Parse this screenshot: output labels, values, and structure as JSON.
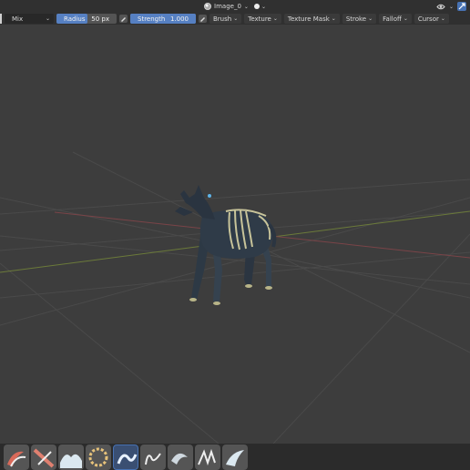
{
  "header": {
    "image_name": "Image_0",
    "icons": [
      "globe-icon",
      "chevron-down-icon",
      "dot-icon",
      "chevron-down-icon",
      "visibility-icon",
      "navigation-gizmo-icon"
    ]
  },
  "toolbar": {
    "blend_mode": "Mix",
    "radius": {
      "label": "Radius",
      "value": "50 px"
    },
    "strength": {
      "label": "Strength",
      "value": "1.000",
      "fraction": 1.0
    },
    "menus": [
      "Brush",
      "Texture",
      "Texture Mask",
      "Stroke",
      "Falloff",
      "Cursor"
    ]
  },
  "colors": {
    "accent": "#4772b3",
    "viewport_bg": "#3d3d3d",
    "header_bg": "#303030"
  },
  "brushes": [
    {
      "name": "brush-draw-icon"
    },
    {
      "name": "brush-soften-icon"
    },
    {
      "name": "brush-smear-icon"
    },
    {
      "name": "brush-clone-icon"
    },
    {
      "name": "brush-fill-icon",
      "active": true
    },
    {
      "name": "brush-mask-icon"
    },
    {
      "name": "brush-blur-icon"
    },
    {
      "name": "brush-strokes-icon"
    },
    {
      "name": "brush-wave-icon"
    }
  ]
}
